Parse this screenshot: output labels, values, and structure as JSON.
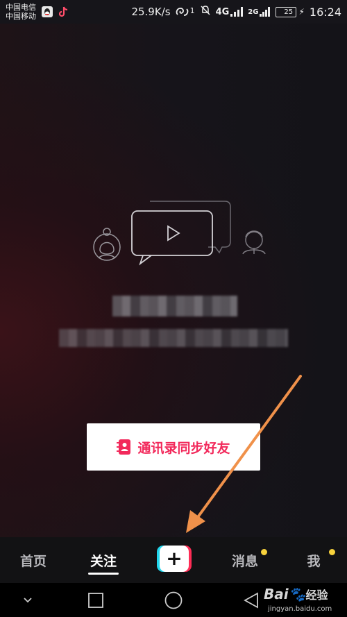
{
  "status_bar": {
    "carrier_1": "中国电信",
    "carrier_2": "中国移动",
    "net_speed": "25.9K/s",
    "nfc_badge": "1",
    "network_1": "4G",
    "network_2": "2G",
    "battery": "25",
    "battery_level_percent": 25,
    "time": "16:24"
  },
  "main": {
    "blurred_title": "",
    "blurred_subtitle": "",
    "sync_contacts_label": "通讯录同步好友"
  },
  "tab_bar": {
    "home": "首页",
    "follow": "关注",
    "create": "+",
    "messages": "消息",
    "me": "我",
    "active_tab": "follow"
  },
  "watermark": {
    "logo_text": "Bai",
    "logo_suffix": "经验",
    "url": "jingyan.baidu.com"
  },
  "colors": {
    "accent_red": "#fe2c55",
    "accent_cyan": "#20d5ec",
    "button_text": "#f2295b",
    "badge_yellow": "#f7d23c",
    "annotation_arrow": "#f0914a"
  }
}
